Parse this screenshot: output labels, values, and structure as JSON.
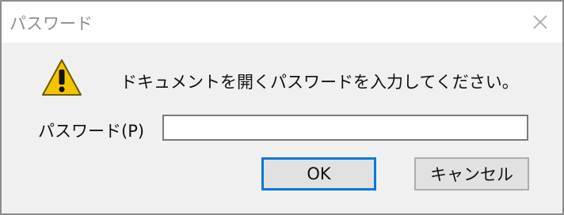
{
  "window": {
    "title": "パスワード",
    "close_icon": "close-icon"
  },
  "dialog": {
    "icon": "warning-icon",
    "message": "ドキュメントを開くパスワードを入力してください。",
    "password_label": "パスワード(P)",
    "password_value": "",
    "password_placeholder": ""
  },
  "buttons": {
    "ok_label": "OK",
    "cancel_label": "キャンセル"
  },
  "colors": {
    "focus_border": "#0a78d7",
    "warning_yellow": "#f5c400",
    "dialog_bg": "#f0f0f0"
  }
}
